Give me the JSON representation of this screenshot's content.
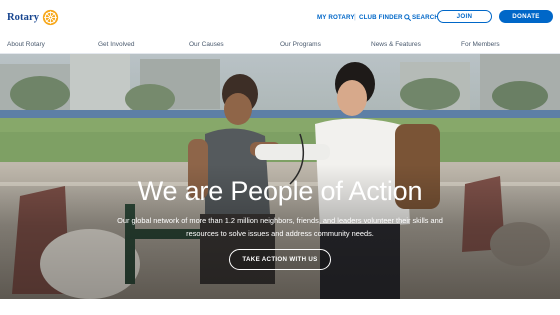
{
  "header": {
    "logo_text": "Rotary",
    "logo_icon": "rotary-wheel-icon",
    "utility_links": {
      "my_rotary": "MY ROTARY",
      "separator": "|",
      "club_finder": "CLUB FINDER",
      "search": "SEARCH"
    },
    "join_label": "JOIN",
    "donate_label": "DONATE"
  },
  "nav": {
    "items": [
      {
        "label": "About Rotary"
      },
      {
        "label": "Get Involved"
      },
      {
        "label": "Our Causes"
      },
      {
        "label": "Our Programs"
      },
      {
        "label": "News & Features"
      },
      {
        "label": "For Members"
      }
    ]
  },
  "hero": {
    "headline": "We are People of Action",
    "subtext": "Our global network of more than 1.2 million neighbors, friends, and leaders volunteer their skills and resources to solve issues and address community needs.",
    "cta_label": "TAKE ACTION WITH US"
  },
  "colors": {
    "brand_blue": "#17458f",
    "link_blue": "#0067c8",
    "gold": "#f7a81b"
  }
}
